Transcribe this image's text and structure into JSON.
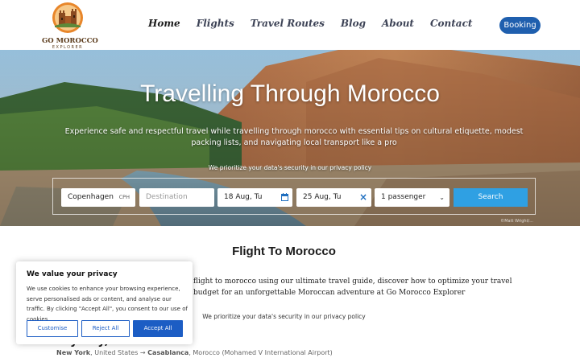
{
  "logo": {
    "name": "GO MOROCCO",
    "sub": "EXPLORER"
  },
  "nav": {
    "items": [
      {
        "label": "Home"
      },
      {
        "label": "Flights"
      },
      {
        "label": "Travel Routes"
      },
      {
        "label": "Blog"
      },
      {
        "label": "About"
      },
      {
        "label": "Contact"
      }
    ]
  },
  "booking_label": "Booking",
  "hero": {
    "title": "Travelling Through Morocco",
    "text": "Experience safe and respectful travel while travelling through morocco with essential tips on cultural etiquette, modest packing lists, and navigating local transport like a pro",
    "privacy": "We prioritize your data's security in our privacy policy",
    "credit": "©Matt Wright/..."
  },
  "search": {
    "origin": "Copenhagen",
    "origin_code": "CPH",
    "destination_placeholder": "Destination",
    "depart": "18 Aug, Tu",
    "return": "25 Aug, Tu",
    "passengers": "1 passenger",
    "button": "Search"
  },
  "section": {
    "title": "Flight To Morocco",
    "body": "flight to morocco using our ultimate travel guide, discover how to optimize your travel budget for an unforgettable Moroccan adventure at Go Morocco Explorer",
    "privacy": "We prioritize your data's security in our privacy policy"
  },
  "flight": {
    "heading": "ery day, from 7h 5m",
    "from_city": "New York",
    "from_country": ", United States → ",
    "to_city": "Casablanca",
    "to_country": ", Morocco (Mohamed V International Airport)"
  },
  "cookie": {
    "title": "We value your privacy",
    "text": "We use cookies to enhance your browsing experience, serve personalised ads or content, and analyse our traffic. By clicking \"Accept All\", you consent to our use of cookies.",
    "customise": "Customise",
    "reject": "Reject All",
    "accept": "Accept All"
  },
  "colors": {
    "accent": "#1f5fae",
    "search": "#2fa0e3",
    "cookie_accent": "#1c5dc4"
  },
  "icons": [
    "logo-emblem",
    "calendar-icon",
    "clear-icon",
    "chevron-down-icon"
  ]
}
